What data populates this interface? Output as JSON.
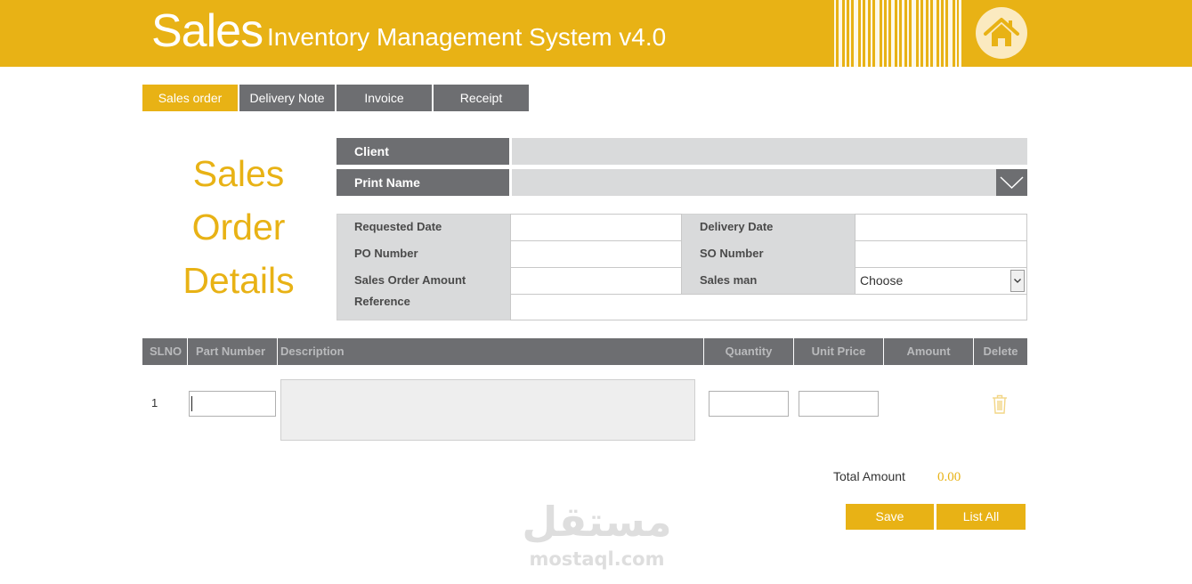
{
  "app": {
    "title_main": "Sales",
    "title_sub": "Inventory Management System v4.0",
    "icons": {
      "home": "home-icon",
      "barcode": "barcode-graphic"
    }
  },
  "colors": {
    "accent": "#E8B215",
    "panel_dark": "#6D6E71",
    "panel_light": "#D9DADB",
    "header_text": "#B9BABC"
  },
  "tabs": [
    {
      "label": "Sales order",
      "active": true
    },
    {
      "label": "Delivery Note",
      "active": false
    },
    {
      "label": "Invoice",
      "active": false
    },
    {
      "label": "Receipt",
      "active": false
    }
  ],
  "page_heading": {
    "line1": "Sales",
    "line2": "Order",
    "line3": "Details"
  },
  "client": {
    "label": "Client",
    "value": ""
  },
  "print_name": {
    "label": "Print Name",
    "value": "",
    "dropdown_icon": "chevron-down-icon"
  },
  "details": {
    "requested_date": {
      "label": "Requested Date",
      "value": ""
    },
    "delivery_date": {
      "label": "Delivery Date",
      "value": ""
    },
    "po_number": {
      "label": "PO Number",
      "value": ""
    },
    "so_number": {
      "label": "SO Number",
      "value": ""
    },
    "sales_order_amount": {
      "label": "Sales Order Amount",
      "value": ""
    },
    "sales_man": {
      "label": "Sales man",
      "selected": "Choose"
    },
    "reference": {
      "label": "Reference",
      "value": ""
    }
  },
  "items_table": {
    "columns": [
      "SLNO",
      "Part Number",
      "Description",
      "Quantity",
      "Unit Price",
      "Amount",
      "Delete"
    ],
    "rows": [
      {
        "slno": "1",
        "part_number": "",
        "description": "",
        "quantity": "",
        "unit_price": "",
        "amount": "",
        "delete_icon": "trash-icon"
      }
    ]
  },
  "totals": {
    "label": "Total Amount",
    "value": "0.00"
  },
  "actions": {
    "save": "Save",
    "list_all": "List All"
  },
  "watermark": {
    "arabic": "مستقل",
    "latin": "mostaql.com"
  }
}
